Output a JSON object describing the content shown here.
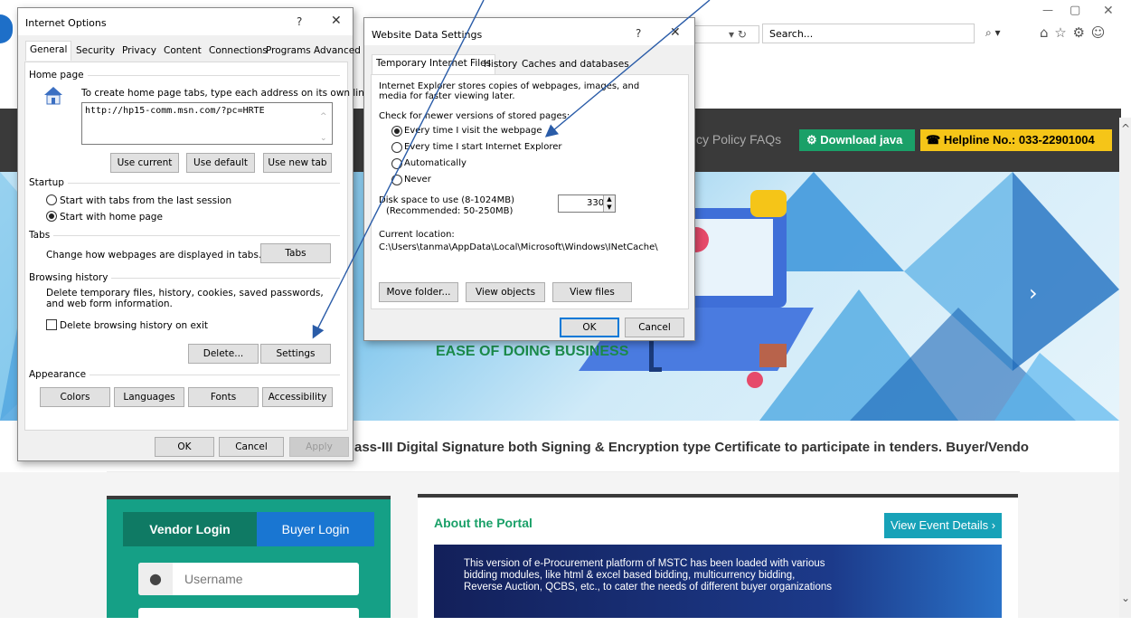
{
  "browser": {
    "address_tail": "▾ ↻",
    "search_placeholder": "Search...",
    "search_icon": "⌕ ▾",
    "minimize": "—",
    "restore": "▢",
    "close": "✕",
    "toolbar_icons": "⌂ ☆ ⚙ ☺"
  },
  "site": {
    "nav_text": "cy Policy  FAQs",
    "download_label": "Download java",
    "helpline_label": "Helpline No.: 033-22901004",
    "hero_text": "EASE OF DOING BUSINESS",
    "ticker": "ass-III Digital Signature both Signing & Encryption type Certificate to participate in tenders.  Buyer/Vendo",
    "vendor_tab": "Vendor Login",
    "buyer_tab": "Buyer Login",
    "username_placeholder": "Username",
    "about_title": "About the Portal",
    "view_events": "View Event Details ›",
    "about_text": "This version of e-Procurement platform of MSTC has been loaded with various bidding modules, like html & excel based bidding, multicurrency bidding, Reverse Auction, QCBS, etc., to cater the needs of different buyer organizations"
  },
  "io": {
    "title": "Internet Options",
    "help": "?",
    "close": "✕",
    "tabs": [
      "General",
      "Security",
      "Privacy",
      "Content",
      "Connections",
      "Programs",
      "Advanced"
    ],
    "homepage_header": "Home page",
    "homepage_desc": "To create home page tabs, type each address on its own line.",
    "homepage_url": "http://hp15-comm.msn.com/?pc=HRTE",
    "use_current": "Use current",
    "use_default": "Use default",
    "use_new_tab": "Use new tab",
    "startup_header": "Startup",
    "startup_opt1": "Start with tabs from the last session",
    "startup_opt2": "Start with home page",
    "tabs_header": "Tabs",
    "tabs_desc": "Change how webpages are displayed in tabs.",
    "tabs_btn": "Tabs",
    "history_header": "Browsing history",
    "history_desc": "Delete temporary files, history, cookies, saved passwords, and web form information.",
    "delete_on_exit": "Delete browsing history on exit",
    "delete_btn": "Delete...",
    "settings_btn": "Settings",
    "appearance_header": "Appearance",
    "colors_btn": "Colors",
    "languages_btn": "Languages",
    "fonts_btn": "Fonts",
    "accessibility_btn": "Accessibility",
    "ok": "OK",
    "cancel": "Cancel",
    "apply": "Apply"
  },
  "wds": {
    "title": "Website Data Settings",
    "help": "?",
    "close": "✕",
    "tabs": [
      "Temporary Internet Files",
      "History",
      "Caches and databases"
    ],
    "desc": "Internet Explorer stores copies of webpages, images, and media for faster viewing later.",
    "check_label": "Check for newer versions of stored pages:",
    "options": [
      "Every time I visit the webpage",
      "Every time I start Internet Explorer",
      "Automatically",
      "Never"
    ],
    "disk_label": "Disk space to use (8-1024MB)",
    "disk_rec": "(Recommended: 50-250MB)",
    "disk_value": "330",
    "location_label": "Current location:",
    "location_path": "C:\\Users\\tanma\\AppData\\Local\\Microsoft\\Windows\\INetCache\\",
    "move_btn": "Move folder...",
    "objects_btn": "View objects",
    "files_btn": "View files",
    "ok": "OK",
    "cancel": "Cancel"
  },
  "colors": {
    "site_dark": "#3a3a3a",
    "green": "#1aa068",
    "yellow": "#f5c518",
    "blue": "#1976d2",
    "teal": "#17a2b8",
    "arrow": "#2a5ca8"
  }
}
